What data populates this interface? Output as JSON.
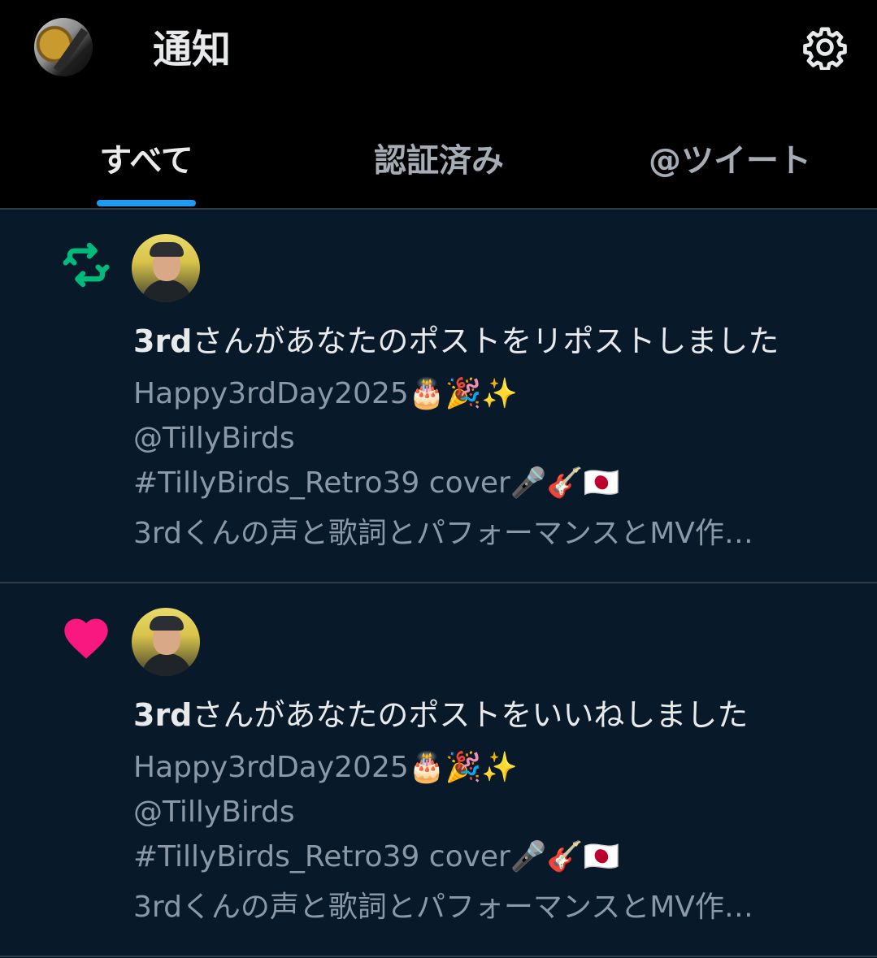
{
  "header": {
    "title": "通知",
    "avatar_icon": "user-avatar",
    "settings_icon": "gear-icon"
  },
  "tabs": [
    {
      "label": "すべて",
      "active": true
    },
    {
      "label": "認証済み",
      "active": false
    },
    {
      "label": "@ツイート",
      "active": false
    }
  ],
  "colors": {
    "accent": "#1d9bf0",
    "repost": "#00ba7c",
    "like": "#f91880",
    "background": "#08192a",
    "header_bg": "#000000"
  },
  "notifications": [
    {
      "type": "repost",
      "icon": "repost-icon",
      "actor": "3rd",
      "action": "さんがあなたのポストをリポストしました",
      "lines": [
        "Happy3rdDay2025🎂🎉✨",
        "@TillyBirds",
        "#TillyBirds_Retro39 cover🎤🎸🇯🇵",
        "3rdくんの声と歌詞とパフォーマンスとMV作…"
      ]
    },
    {
      "type": "like",
      "icon": "heart-icon",
      "actor": "3rd",
      "action": "さんがあなたのポストをいいねしました",
      "lines": [
        "Happy3rdDay2025🎂🎉✨",
        "@TillyBirds",
        "#TillyBirds_Retro39 cover🎤🎸🇯🇵",
        "3rdくんの声と歌詞とパフォーマンスとMV作…"
      ]
    }
  ]
}
